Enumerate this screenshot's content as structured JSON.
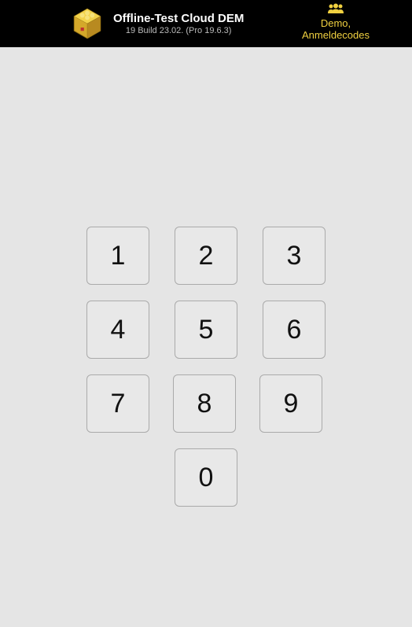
{
  "header": {
    "title_main": "Offline-Test Cloud DEM",
    "title_sub": "19 Build 23.02. (Pro 19.6.3)",
    "right_line1": "Demo,",
    "right_line2": "Anmeldecodes"
  },
  "keypad": {
    "keys": [
      "1",
      "2",
      "3",
      "4",
      "5",
      "6",
      "7",
      "8",
      "9",
      "0"
    ]
  }
}
